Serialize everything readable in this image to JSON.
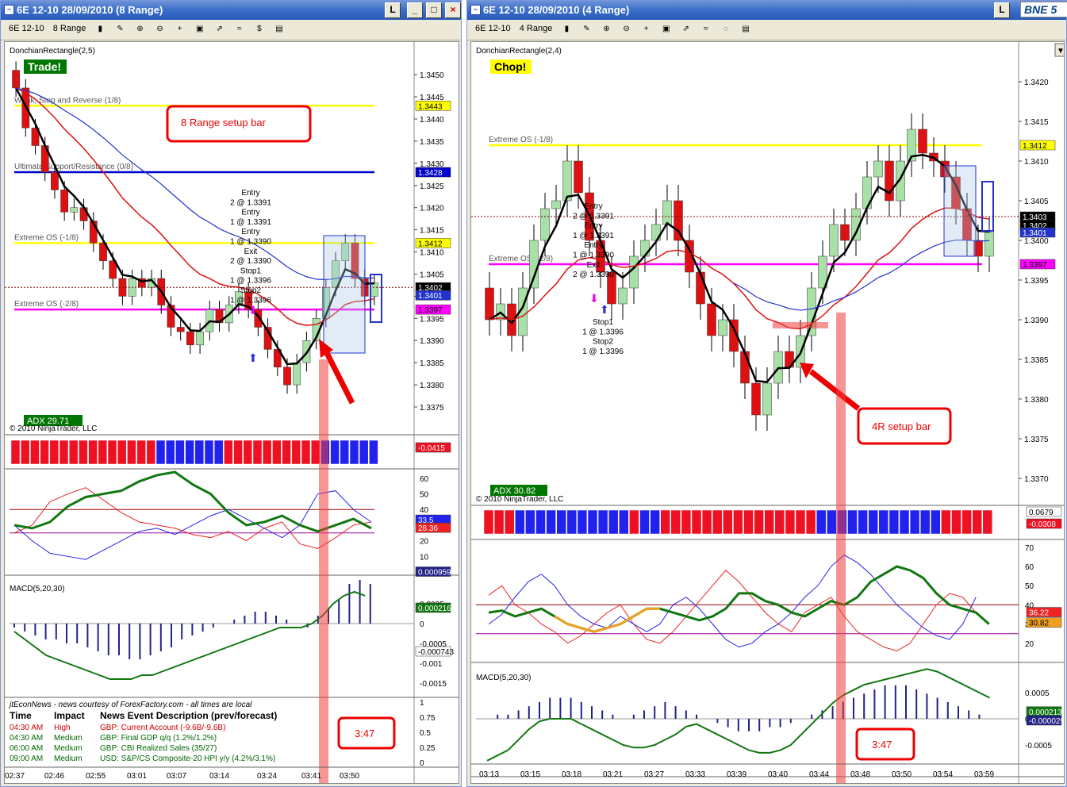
{
  "left": {
    "title": "6E 12-10  28/09/2010 (8 Range)",
    "instrument": "6E 12-10",
    "period": "8 Range",
    "indicator_label": "DonchianRectangle(2,5)",
    "badge": "Trade!",
    "badge_color": "#007700",
    "lines": [
      {
        "label": "Weak, Stop and Reverse (1/8)",
        "value": 1.3443,
        "price_text": "1.3443",
        "color": "#ffff00"
      },
      {
        "label": "Ultimate Support/Resistance (0/8)",
        "value": 1.3428,
        "price_text": "1.3428",
        "color": "#0000cc"
      },
      {
        "label": "Extreme OS (-1/8)",
        "value": 1.3412,
        "price_text": "1.3412",
        "color": "#ffff00"
      },
      {
        "label": "Extreme OS (-2/8)",
        "value": 1.3397,
        "price_text": "1.3397",
        "color": "#ff00ff"
      }
    ],
    "price_axis": [
      "1.3450",
      "1.3445",
      "1.3440",
      "1.3435",
      "1.3430",
      "1.3425",
      "1.3420",
      "1.3415",
      "1.3410",
      "1.3405",
      "1.3400",
      "1.3395",
      "1.3390",
      "1.3385",
      "1.3380",
      "1.3375"
    ],
    "current_price": "1.3402",
    "blue_price": "1.3401",
    "callout": "8 Range setup bar",
    "trade_text": [
      "Entry",
      "2 @ 1.3391",
      "Entry",
      "1 @ 1.3391",
      "Entry",
      "1 @ 1.3390",
      "Exit",
      "2 @ 1.3390",
      "Stop1",
      "1 @ 1.3396",
      "Stop2",
      "1 @ 1.3396"
    ],
    "adx": "ADX 29.71",
    "copyright": "© 2010 NinjaTrader, LLC",
    "trend_value": "-0.0415",
    "osc_axis": [
      "60",
      "50",
      "40",
      "30",
      "20",
      "10"
    ],
    "osc_labels": [
      "33.5",
      "28.36"
    ],
    "macd_label": "MACD(5,20,30)",
    "macd_axis": [
      "0.0005",
      "0",
      "-0.0005",
      "-0.001",
      "-0.0015"
    ],
    "macd_values": [
      "0.000959",
      "0.000216",
      "-0.000743"
    ],
    "news_axis": [
      "1",
      "0.75",
      "0.5",
      "0.25",
      "0"
    ],
    "news_header": "jtEconNews - news courtesy of ForexFactory.com - all times are local",
    "news_cols": [
      "Time",
      "Impact",
      "News Event Description (prev/forecast)"
    ],
    "news": [
      {
        "time": "04:30 AM",
        "impact": "High",
        "desc": "GBP: Current Account (-9.6B/-9.6B)",
        "color": "#cc0000"
      },
      {
        "time": "04:30 AM",
        "impact": "Medium",
        "desc": "GBP: Final GDP q/q (1.2%/1.2%)",
        "color": "#006600"
      },
      {
        "time": "06:00 AM",
        "impact": "Medium",
        "desc": "GBP: CBI Realized Sales (35/27)",
        "color": "#006600"
      },
      {
        "time": "09:00 AM",
        "impact": "Medium",
        "desc": "USD: S&P/CS Composite-20 HPI y/y (4.2%/3.1%)",
        "color": "#006600"
      }
    ],
    "time_box": "3:47",
    "x_axis": [
      "02:37",
      "02:46",
      "02:55",
      "03:01",
      "03:07",
      "03:14",
      "03:24",
      "03:41",
      "03:50"
    ]
  },
  "right": {
    "title": "6E 12-10  28/09/2010 (4 Range)",
    "instrument": "6E 12-10",
    "period": "4 Range",
    "corner_label": "BNE 5",
    "indicator_label": "DonchianRectangle(2,4)",
    "badge": "Chop!",
    "badge_color": "#ffff00",
    "lines": [
      {
        "label": "Extreme OS (-1/8)",
        "value": 1.3412,
        "price_text": "1.3412",
        "color": "#ffff00"
      },
      {
        "label": "Extreme OS (-2/8)",
        "value": 1.3397,
        "price_text": "1.3397",
        "color": "#ff00ff"
      }
    ],
    "price_axis": [
      "1.3420",
      "1.3415",
      "1.3410",
      "1.3405",
      "1.3400",
      "1.3395",
      "1.3390",
      "1.3385",
      "1.3380",
      "1.3375",
      "1.3370"
    ],
    "current_price": "1.3403",
    "mid_price": "1.3402",
    "blue_price": "1.3401",
    "callout": "4R setup bar",
    "trade_text": [
      "Entry",
      "2 @ 1.3391",
      "Entry",
      "1 @ 1.3391",
      "Entry",
      "1 @ 1.3390",
      "Exit",
      "2 @ 1.3390"
    ],
    "trade_text2": [
      "Stop1",
      "1 @ 1.3396",
      "Stop2",
      "1 @ 1.3396"
    ],
    "adx": "ADX 30.82",
    "copyright": "© 2010 NinjaTrader, LLC",
    "trend_values": [
      "0.0679",
      "-0.0308"
    ],
    "osc_axis": [
      "70",
      "60",
      "50",
      "40",
      "30",
      "20"
    ],
    "osc_labels": [
      "36.22",
      "30.82"
    ],
    "macd_label": "MACD(5,20,30)",
    "macd_axis": [
      "0.0005",
      "0",
      "-0.0005"
    ],
    "macd_values": [
      "0.000213",
      "-0.000029"
    ],
    "time_box": "3:47",
    "x_axis": [
      "03:13",
      "03:15",
      "03:18",
      "03:21",
      "03:27",
      "03:33",
      "03:39",
      "03:40",
      "03:44",
      "03:48",
      "03:50",
      "03:54",
      "03:59"
    ]
  },
  "chart_data": [
    {
      "type": "candlestick",
      "title": "6E 12-10 28/09/2010 (8 Range)",
      "ylim": [
        1.3375,
        1.3452
      ],
      "closes": [
        1.3447,
        1.3438,
        1.3434,
        1.3428,
        1.3424,
        1.3419,
        1.342,
        1.3417,
        1.3412,
        1.3408,
        1.3404,
        1.34,
        1.3404,
        1.3402,
        1.3404,
        1.3398,
        1.3393,
        1.3392,
        1.3389,
        1.3392,
        1.3397,
        1.3394,
        1.3398,
        1.3401,
        1.3397,
        1.3393,
        1.3388,
        1.3384,
        1.338,
        1.3385,
        1.339,
        1.3395,
        1.3402,
        1.3408,
        1.3412,
        1.3404,
        1.34,
        1.3403
      ]
    },
    {
      "type": "candlestick",
      "title": "6E 12-10 28/09/2010 (4 Range)",
      "ylim": [
        1.3367,
        1.3423
      ],
      "closes": [
        1.339,
        1.3392,
        1.3388,
        1.3394,
        1.34,
        1.3404,
        1.3405,
        1.341,
        1.3406,
        1.34,
        1.3396,
        1.3392,
        1.3394,
        1.3398,
        1.34,
        1.3402,
        1.3405,
        1.34,
        1.3396,
        1.3392,
        1.3388,
        1.339,
        1.3386,
        1.3382,
        1.3378,
        1.3382,
        1.3386,
        1.3384,
        1.3388,
        1.3394,
        1.3398,
        1.3402,
        1.34,
        1.3404,
        1.3408,
        1.341,
        1.3405,
        1.341,
        1.3414,
        1.3411,
        1.341,
        1.3408,
        1.3404,
        1.34,
        1.3398,
        1.3401
      ]
    }
  ]
}
